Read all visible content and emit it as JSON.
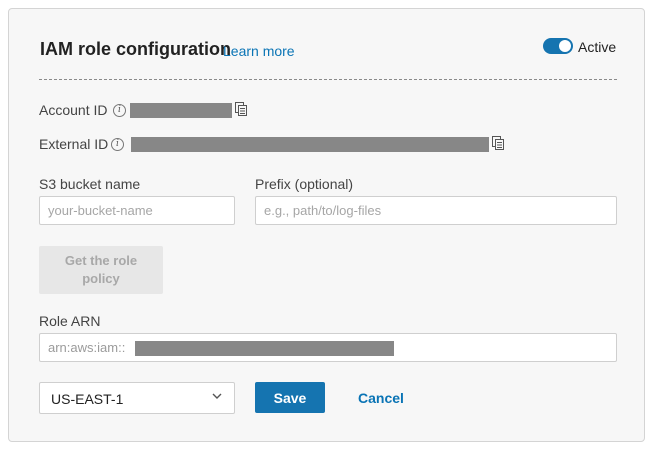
{
  "header": {
    "title": "IAM role configuration",
    "learn_more": "Learn more",
    "status_label": "Active"
  },
  "account_id": {
    "label": "Account ID"
  },
  "external_id": {
    "label": "External ID"
  },
  "s3_bucket": {
    "label": "S3 bucket name",
    "placeholder": "your-bucket-name"
  },
  "prefix": {
    "label": "Prefix (optional)",
    "placeholder": "e.g., path/to/log-files"
  },
  "get_policy_button": "Get the role policy",
  "role_arn": {
    "label": "Role ARN",
    "value_prefix": "arn:aws:iam::"
  },
  "region_select": {
    "value": "US-EAST-1"
  },
  "actions": {
    "save": "Save",
    "cancel": "Cancel"
  },
  "colors": {
    "accent": "#1574b0",
    "link": "#0a74b5",
    "redaction": "#878787"
  }
}
